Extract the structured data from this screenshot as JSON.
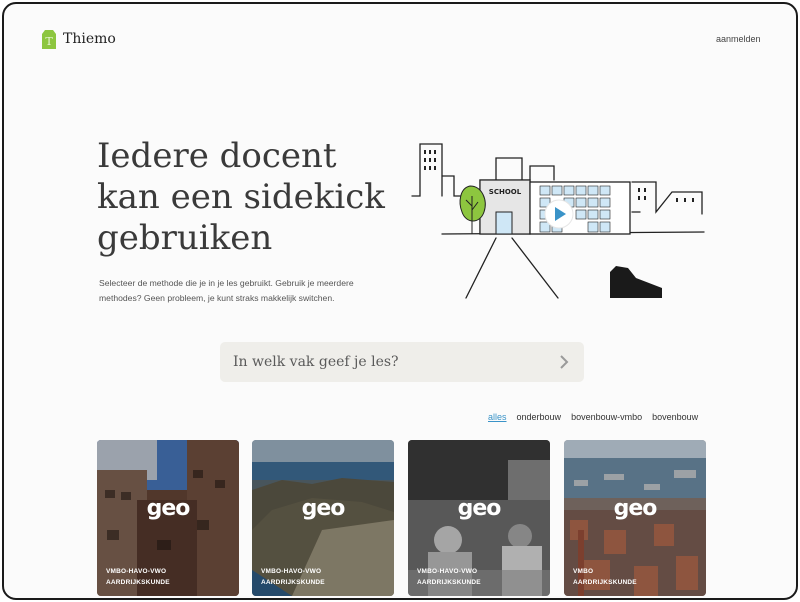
{
  "header": {
    "brand": "Thiemo",
    "login_label": "aanmelden"
  },
  "hero": {
    "title_lines": [
      "Iedere docent",
      "kan een sidekick",
      "gebruiken"
    ],
    "subtitle_line1": "Selecteer de methode die je in je les gebruikt. Gebruik je meerdere",
    "subtitle_line2": "methodes? Geen probleem, je kunt straks makkelijk switchen.",
    "illustration_sign": "SCHOOL"
  },
  "search": {
    "placeholder": "In welk vak geef je les?"
  },
  "filters": [
    {
      "label": "alles",
      "active": true
    },
    {
      "label": "onderbouw",
      "active": false
    },
    {
      "label": "bovenbouw-vmbo",
      "active": false
    },
    {
      "label": "bovenbouw",
      "active": false
    }
  ],
  "cards": [
    {
      "brand": "geo",
      "level": "VMBO-HAVO-VWO",
      "subject": "AARDRIJKSKUNDE"
    },
    {
      "brand": "geo",
      "level": "VMBO-HAVO-VWO",
      "subject": "AARDRIJKSKUNDE"
    },
    {
      "brand": "geo",
      "level": "VMBO-HAVO-VWO",
      "subject": "AARDRIJKSKUNDE"
    },
    {
      "brand": "geo",
      "level": "VMBO",
      "subject": "AARDRIJKSKUNDE"
    }
  ],
  "colors": {
    "brand_green": "#8dc63f",
    "accent_blue": "#3a93c8",
    "search_bg": "#efeeea"
  }
}
